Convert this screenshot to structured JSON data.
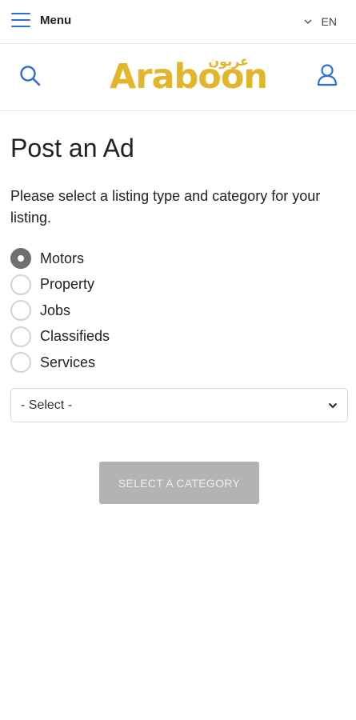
{
  "topbar": {
    "menu_label": "Menu",
    "menu_icon": "hamburger-icon",
    "language": "EN",
    "language_icon": "chevron-down-icon"
  },
  "header": {
    "search_icon": "search-icon",
    "user_icon": "user-icon",
    "logo": {
      "latin": "Araboon",
      "arabic": "عربون",
      "color": "#e3b52a"
    }
  },
  "page": {
    "title": "Post an Ad",
    "intro": "Please select a listing type and category for your listing."
  },
  "listing_types": [
    {
      "label": "Motors",
      "selected": true
    },
    {
      "label": "Property",
      "selected": false
    },
    {
      "label": "Jobs",
      "selected": false
    },
    {
      "label": "Classifieds",
      "selected": false
    },
    {
      "label": "Services",
      "selected": false
    }
  ],
  "category_select": {
    "value": "- Select -",
    "icon": "chevron-down-icon"
  },
  "submit": {
    "label": "SELECT A CATEGORY",
    "disabled": true
  },
  "colors": {
    "accent": "#2f6fd1",
    "brand": "#e3b52a",
    "disabled_button": "#b3b3b3",
    "radio_checked": "#6f6f6f"
  }
}
